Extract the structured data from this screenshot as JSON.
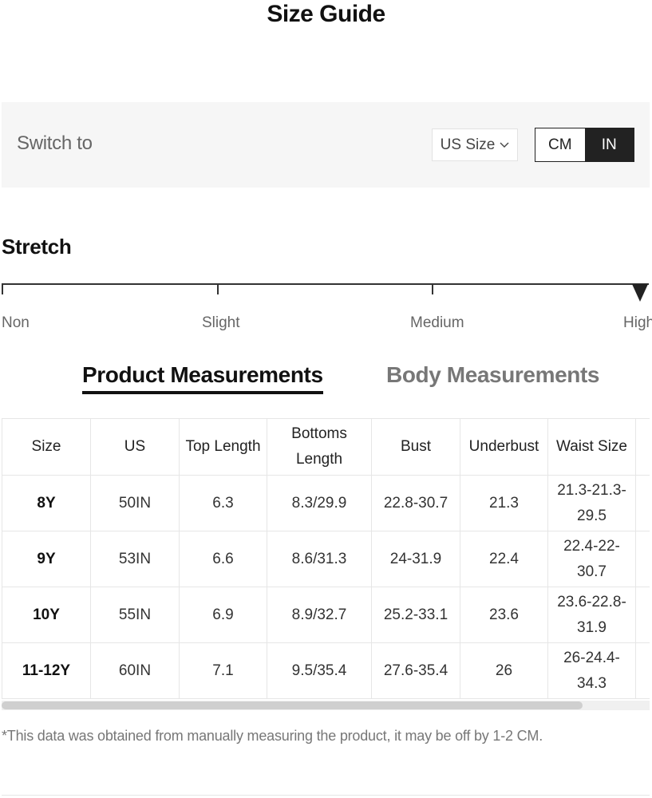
{
  "page": {
    "title": "Size Guide"
  },
  "switch_bar": {
    "label": "Switch to",
    "size_select": {
      "value": "US Size",
      "icon": "chevron-down-icon"
    },
    "unit_toggle": {
      "cm_label": "CM",
      "in_label": "IN",
      "selected": "IN"
    }
  },
  "stretch": {
    "title": "Stretch",
    "levels": [
      "Non",
      "Slight",
      "Medium",
      "High"
    ],
    "selected": "High"
  },
  "tabs": {
    "product": "Product Measurements",
    "body": "Body Measurements",
    "active": "Product Measurements"
  },
  "table": {
    "headers": [
      "Size",
      "US",
      "Top Length",
      "Bottoms Length",
      "Bust",
      "Underbust",
      "Waist Size"
    ],
    "rows": [
      [
        "8Y",
        "50IN",
        "6.3",
        "8.3/29.9",
        "22.8-30.7",
        "21.3",
        "21.3-21.3-29.5"
      ],
      [
        "9Y",
        "53IN",
        "6.6",
        "8.6/31.3",
        "24-31.9",
        "22.4",
        "22.4-22-30.7"
      ],
      [
        "10Y",
        "55IN",
        "6.9",
        "8.9/32.7",
        "25.2-33.1",
        "23.6",
        "23.6-22.8-31.9"
      ],
      [
        "11-12Y",
        "60IN",
        "7.1",
        "9.5/35.4",
        "27.6-35.4",
        "26",
        "26-24.4-34.3"
      ]
    ]
  },
  "footnote": "*This data was obtained from manually measuring the product, it may be off by 1-2 CM.",
  "colors": {
    "accent": "#222222",
    "bar_background": "#f6f6f6",
    "muted_text": "#777777"
  }
}
